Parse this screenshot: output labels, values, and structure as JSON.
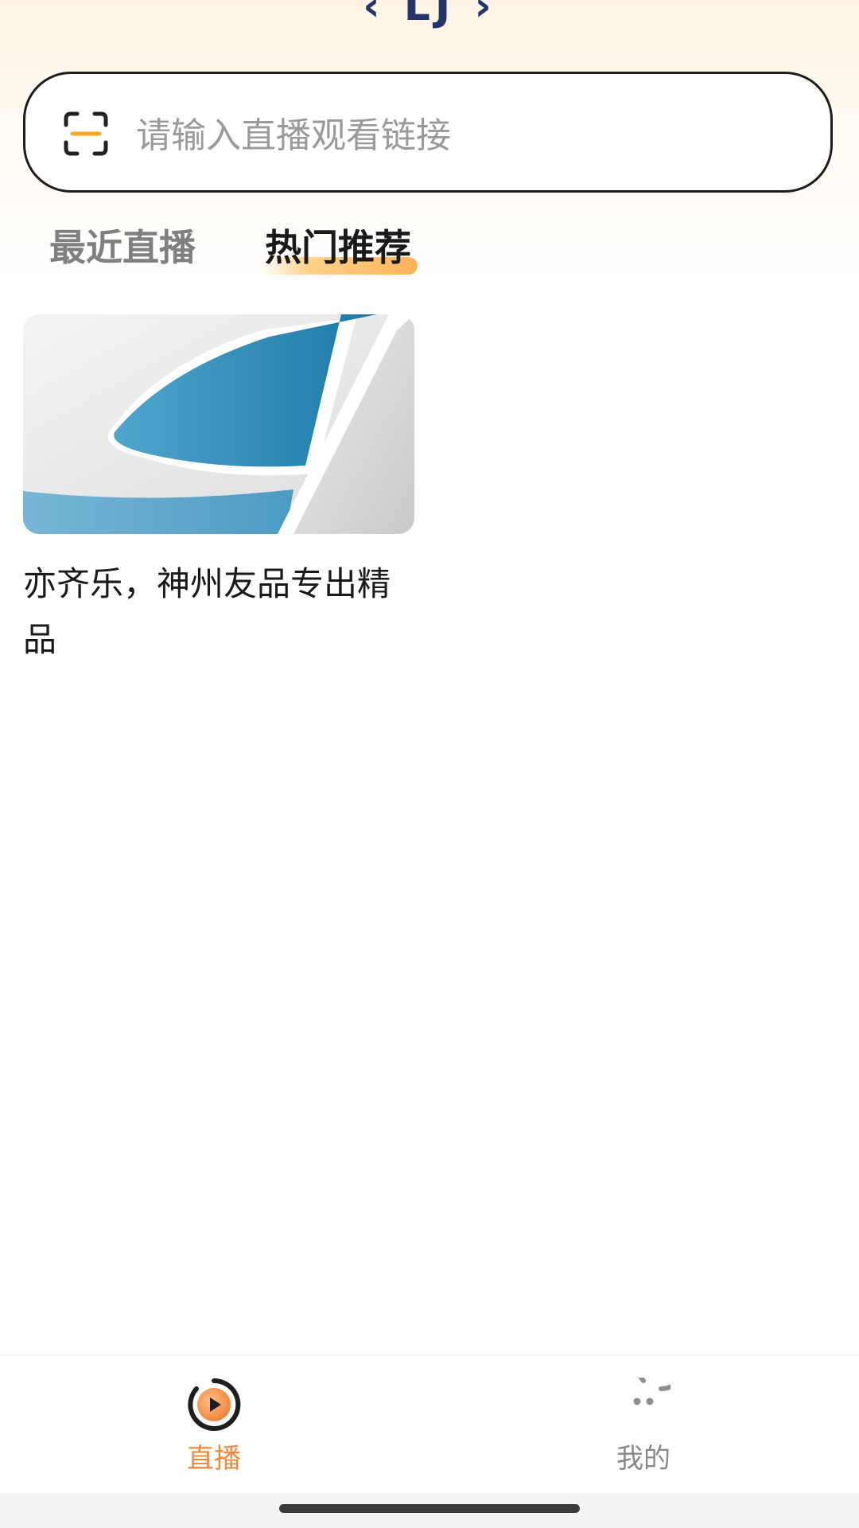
{
  "header": {
    "logo_text": "‹ LJ ›"
  },
  "search": {
    "placeholder": "请输入直播观看链接",
    "scan_icon": "scan-icon"
  },
  "tabs": [
    {
      "label": "最近直播",
      "active": false
    },
    {
      "label": "热门推荐",
      "active": true
    }
  ],
  "cards": [
    {
      "title": "亦齐乐，神州友品专出精品",
      "thumbnail": "abstract-blue-white-architecture"
    }
  ],
  "bottom_nav": {
    "items": [
      {
        "label": "直播",
        "icon": "live-play-icon",
        "active": true
      },
      {
        "label": "我的",
        "icon": "smiley-profile-icon",
        "active": false
      }
    ]
  },
  "colors": {
    "accent": "#f08a3a",
    "text_primary": "#1a1a1a",
    "text_muted": "#9a9a9a",
    "logo": "#22346b"
  }
}
